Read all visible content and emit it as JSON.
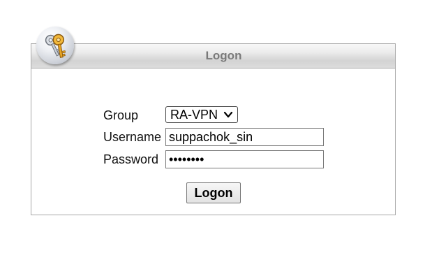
{
  "header": {
    "title": "Logon"
  },
  "icon": {
    "name": "keys-icon"
  },
  "form": {
    "group": {
      "label": "Group",
      "selected": "RA-VPN"
    },
    "username": {
      "label": "Username",
      "value": "suppachok_sin"
    },
    "password": {
      "label": "Password",
      "value": "••••••••"
    },
    "submit_label": "Logon"
  },
  "colors": {
    "panel_border": "#a8a8a8",
    "title_text": "#7a7a7a",
    "header_gradient_top": "#f8f8f8",
    "header_gradient_bottom": "#d3d3d3"
  }
}
